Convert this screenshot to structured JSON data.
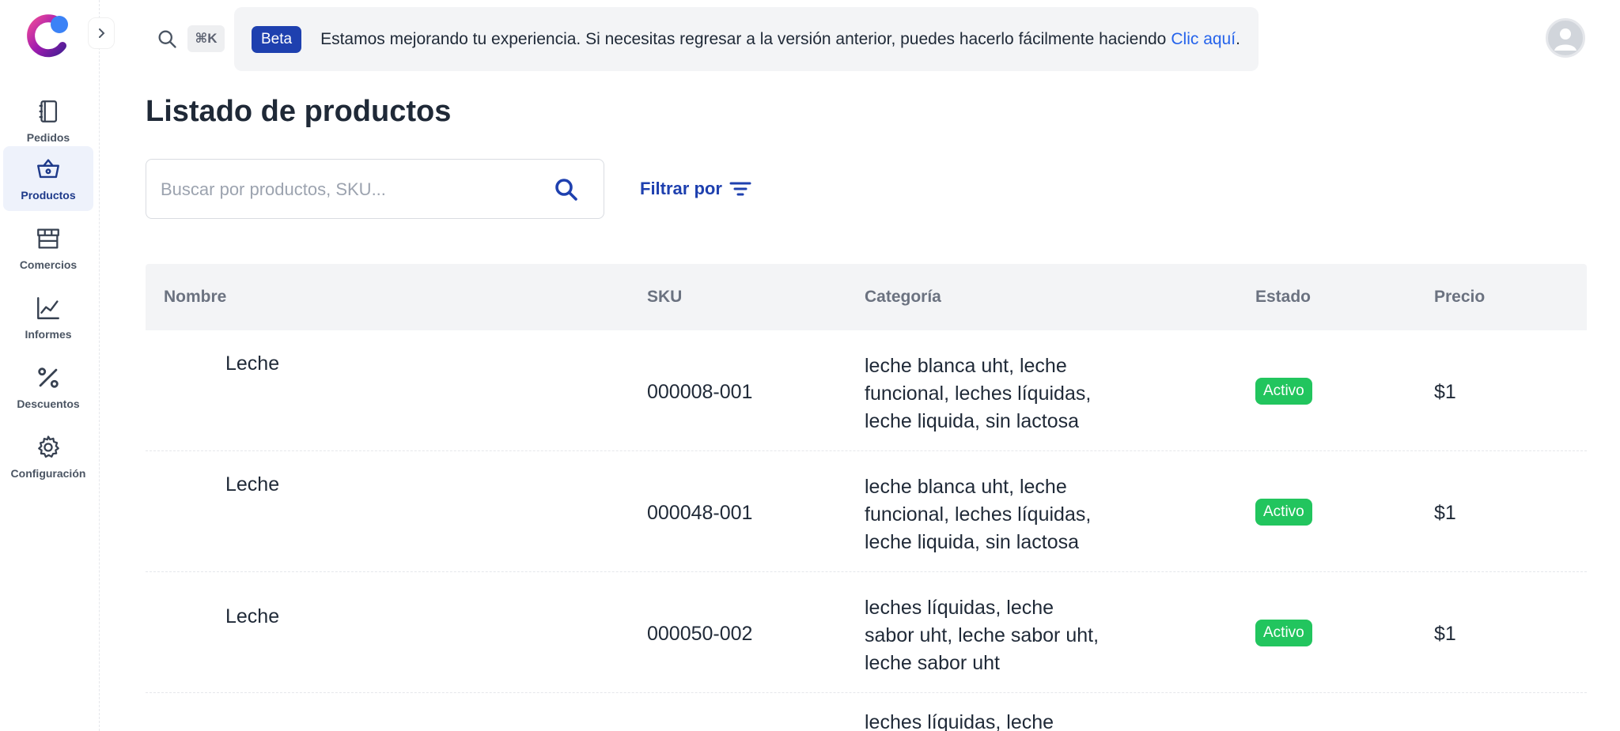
{
  "sidebar": {
    "items": [
      {
        "label": "Pedidos",
        "icon": "notebook-icon",
        "active": false
      },
      {
        "label": "Productos",
        "icon": "basket-icon",
        "active": true
      },
      {
        "label": "Comercios",
        "icon": "store-icon",
        "active": false
      },
      {
        "label": "Informes",
        "icon": "chart-line-icon",
        "active": false
      },
      {
        "label": "Descuentos",
        "icon": "percent-icon",
        "active": false
      },
      {
        "label": "Configuración",
        "icon": "gear-icon",
        "active": false
      }
    ]
  },
  "topbar": {
    "shortcut": "⌘K",
    "banner": {
      "badge": "Beta",
      "text": "Estamos mejorando tu experiencia. Si necesitas regresar a la versión anterior, puedes hacerlo fácilmente haciendo",
      "link": "Clic aquí",
      "end": "."
    }
  },
  "main": {
    "title": "Listado de productos",
    "search_placeholder": "Buscar por productos, SKU...",
    "filter_label": "Filtrar por"
  },
  "table": {
    "columns": [
      "Nombre",
      "SKU",
      "Categoría",
      "Estado",
      "Precio"
    ],
    "rows": [
      {
        "name": "Leche",
        "sku": "000008-001",
        "category": "leche blanca uht, leche funcional, leches líquidas, leche liquida, sin lactosa",
        "status": "Activo",
        "price": "$1"
      },
      {
        "name": "Leche",
        "sku": "000048-001",
        "category": "leche blanca uht, leche funcional, leches líquidas, leche liquida, sin lactosa",
        "status": "Activo",
        "price": "$1"
      },
      {
        "name": "Leche",
        "sku": "000050-002",
        "category": "leches líquidas, leche sabor uht, leche sabor uht, leche sabor uht",
        "status": "Activo",
        "price": "$1"
      }
    ],
    "partial_row_category": "leches líquidas, leche"
  },
  "colors": {
    "brand": "#1e40af",
    "active_status": "#22c55e",
    "link": "#2563eb",
    "sidebar_active_bg": "#eef2fb"
  }
}
